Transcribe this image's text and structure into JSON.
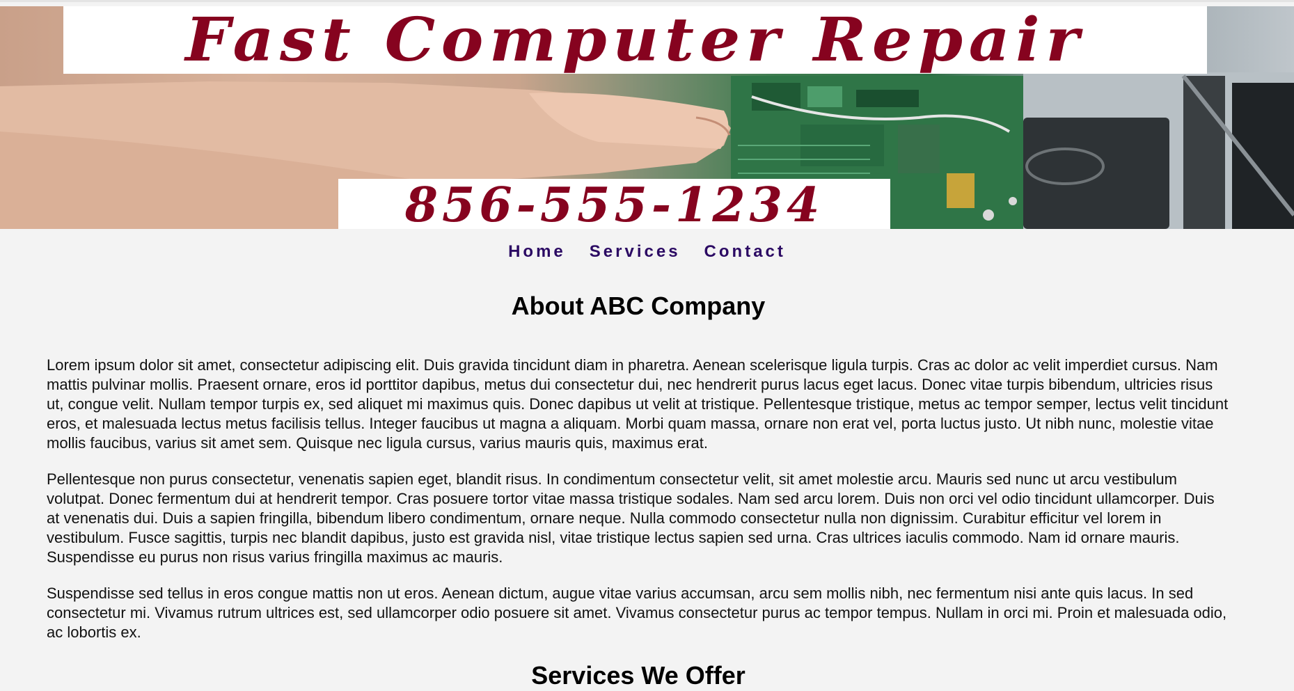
{
  "banner": {
    "title": "Fast Computer Repair",
    "phone": "856-555-1234"
  },
  "nav": {
    "items": [
      "Home",
      "Services",
      "Contact"
    ]
  },
  "about": {
    "heading": "About ABC Company",
    "paragraphs": [
      "Lorem ipsum dolor sit amet, consectetur adipiscing elit. Duis gravida tincidunt diam in pharetra. Aenean scelerisque ligula turpis. Cras ac dolor ac velit imperdiet cursus. Nam mattis pulvinar mollis. Praesent ornare, eros id porttitor dapibus, metus dui consectetur dui, nec hendrerit purus lacus eget lacus. Donec vitae turpis bibendum, ultricies risus ut, congue velit. Nullam tempor turpis ex, sed aliquet mi maximus quis. Donec dapibus ut velit at tristique. Pellentesque tristique, metus ac tempor semper, lectus velit tincidunt eros, et malesuada lectus metus facilisis tellus. Integer faucibus ut magna a aliquam. Morbi quam massa, ornare non erat vel, porta luctus justo. Ut nibh nunc, molestie vitae mollis faucibus, varius sit amet sem. Quisque nec ligula cursus, varius mauris quis, maximus erat.",
      "Pellentesque non purus consectetur, venenatis sapien eget, blandit risus. In condimentum consectetur velit, sit amet molestie arcu. Mauris sed nunc ut arcu vestibulum volutpat. Donec fermentum dui at hendrerit tempor. Cras posuere tortor vitae massa tristique sodales. Nam sed arcu lorem. Duis non orci vel odio tincidunt ullamcorper. Duis at venenatis dui. Duis a sapien fringilla, bibendum libero condimentum, ornare neque. Nulla commodo consectetur nulla non dignissim. Curabitur efficitur vel lorem in vestibulum. Fusce sagittis, turpis nec blandit dapibus, justo est gravida nisl, vitae tristique lectus sapien sed urna. Cras ultrices iaculis commodo. Nam id ornare mauris. Suspendisse eu purus non risus varius fringilla maximus ac mauris.",
      "Suspendisse sed tellus in eros congue mattis non ut eros. Aenean dictum, augue vitae varius accumsan, arcu sem mollis nibh, nec fermentum nisi ante quis lacus. In sed consectetur mi. Vivamus rutrum ultrices est, sed ullamcorper odio posuere sit amet. Vivamus consectetur purus ac tempor tempus. Nullam in orci mi. Proin et malesuada odio, ac lobortis ex."
    ]
  },
  "services": {
    "heading": "Services We Offer"
  },
  "colors": {
    "brand_red": "#86031f",
    "nav_purple": "#2b0a63",
    "page_bg": "#f3f3f3"
  }
}
